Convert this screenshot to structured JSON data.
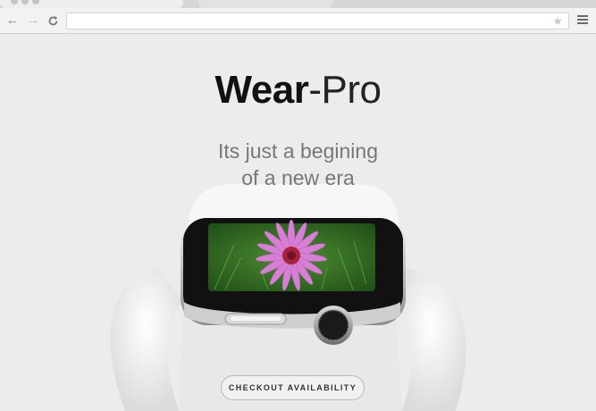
{
  "browser": {
    "back_icon": "arrow-left-icon",
    "forward_icon": "arrow-right-icon",
    "reload_icon": "reload-icon",
    "address_value": "",
    "bookmark_icon": "star-icon",
    "menu_icon": "hamburger-menu-icon"
  },
  "hero": {
    "brand_bold": "Wear",
    "brand_light": "-Pro",
    "tagline_line1": "Its just a begining",
    "tagline_line2": "of a new era",
    "cta_label": "CHECKOUT AVAILABILITY"
  },
  "colors": {
    "page_background": "#ececec",
    "brand_text": "#111111",
    "tagline_text": "#777777",
    "flower_petals": "#d77fd4",
    "foliage": "#3b7a2a"
  }
}
